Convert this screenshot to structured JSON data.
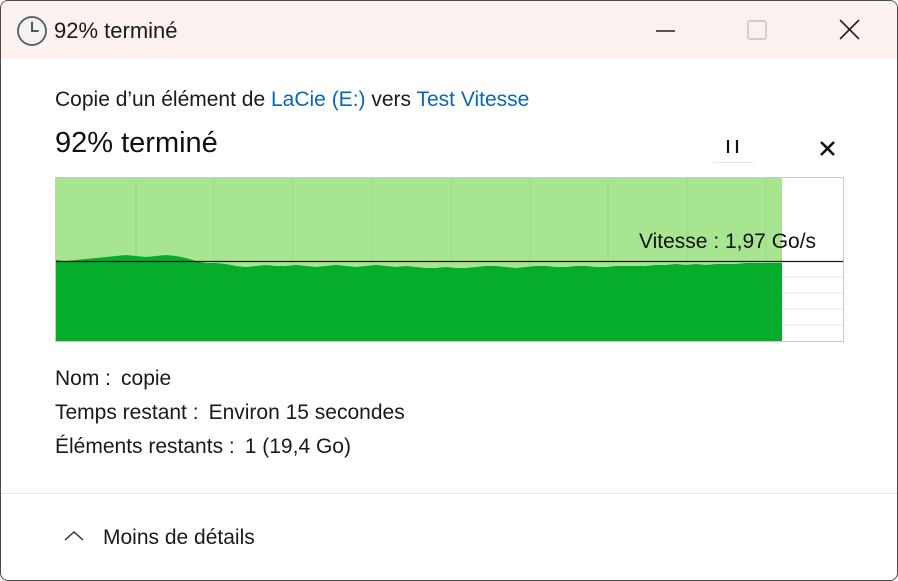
{
  "window": {
    "title": "92% terminé"
  },
  "copy": {
    "prefix": "Copie d’un élément de ",
    "source": "LaCie (E:)",
    "middle": " vers ",
    "destination": "Test Vitesse"
  },
  "progress": {
    "heading": "92% terminé",
    "percent": 92
  },
  "graph": {
    "speed_label": "Vitesse : 1,97 Go/s",
    "colors": {
      "completed_background": "#a8e590",
      "throughput_fill": "#06ad2b",
      "speed_line": "#1a1a1a"
    }
  },
  "details": {
    "name_label": "Nom :",
    "name_value": "copie",
    "time_label": "Temps restant :",
    "time_value": "Environ 15 secondes",
    "items_label": "Éléments restants :",
    "items_value": "1 (19,4 Go)"
  },
  "footer": {
    "toggle_label": "Moins de détails"
  },
  "icons": {
    "title": "clock-icon",
    "minimize": "minimize-icon",
    "maximize": "maximize-icon",
    "close": "close-icon",
    "pause": "pause-icon",
    "cancel": "cancel-icon",
    "toggle": "chevron-up-icon"
  }
}
